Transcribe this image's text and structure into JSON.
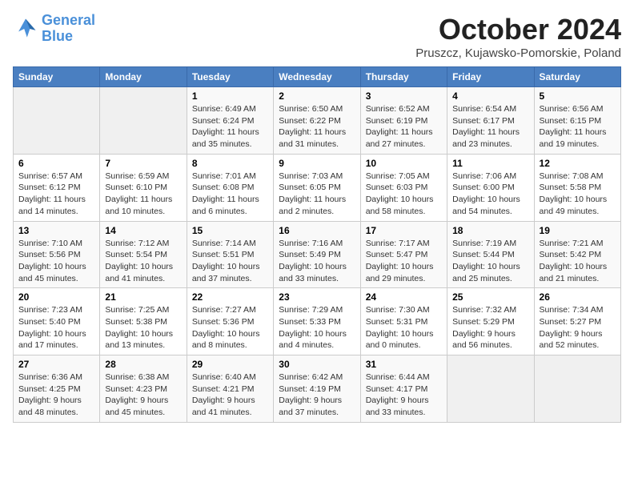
{
  "header": {
    "logo_line1": "General",
    "logo_line2": "Blue",
    "month": "October 2024",
    "location": "Pruszcz, Kujawsko-Pomorskie, Poland"
  },
  "days_of_week": [
    "Sunday",
    "Monday",
    "Tuesday",
    "Wednesday",
    "Thursday",
    "Friday",
    "Saturday"
  ],
  "weeks": [
    [
      {
        "num": "",
        "info": ""
      },
      {
        "num": "",
        "info": ""
      },
      {
        "num": "1",
        "info": "Sunrise: 6:49 AM\nSunset: 6:24 PM\nDaylight: 11 hours and 35 minutes."
      },
      {
        "num": "2",
        "info": "Sunrise: 6:50 AM\nSunset: 6:22 PM\nDaylight: 11 hours and 31 minutes."
      },
      {
        "num": "3",
        "info": "Sunrise: 6:52 AM\nSunset: 6:19 PM\nDaylight: 11 hours and 27 minutes."
      },
      {
        "num": "4",
        "info": "Sunrise: 6:54 AM\nSunset: 6:17 PM\nDaylight: 11 hours and 23 minutes."
      },
      {
        "num": "5",
        "info": "Sunrise: 6:56 AM\nSunset: 6:15 PM\nDaylight: 11 hours and 19 minutes."
      }
    ],
    [
      {
        "num": "6",
        "info": "Sunrise: 6:57 AM\nSunset: 6:12 PM\nDaylight: 11 hours and 14 minutes."
      },
      {
        "num": "7",
        "info": "Sunrise: 6:59 AM\nSunset: 6:10 PM\nDaylight: 11 hours and 10 minutes."
      },
      {
        "num": "8",
        "info": "Sunrise: 7:01 AM\nSunset: 6:08 PM\nDaylight: 11 hours and 6 minutes."
      },
      {
        "num": "9",
        "info": "Sunrise: 7:03 AM\nSunset: 6:05 PM\nDaylight: 11 hours and 2 minutes."
      },
      {
        "num": "10",
        "info": "Sunrise: 7:05 AM\nSunset: 6:03 PM\nDaylight: 10 hours and 58 minutes."
      },
      {
        "num": "11",
        "info": "Sunrise: 7:06 AM\nSunset: 6:00 PM\nDaylight: 10 hours and 54 minutes."
      },
      {
        "num": "12",
        "info": "Sunrise: 7:08 AM\nSunset: 5:58 PM\nDaylight: 10 hours and 49 minutes."
      }
    ],
    [
      {
        "num": "13",
        "info": "Sunrise: 7:10 AM\nSunset: 5:56 PM\nDaylight: 10 hours and 45 minutes."
      },
      {
        "num": "14",
        "info": "Sunrise: 7:12 AM\nSunset: 5:54 PM\nDaylight: 10 hours and 41 minutes."
      },
      {
        "num": "15",
        "info": "Sunrise: 7:14 AM\nSunset: 5:51 PM\nDaylight: 10 hours and 37 minutes."
      },
      {
        "num": "16",
        "info": "Sunrise: 7:16 AM\nSunset: 5:49 PM\nDaylight: 10 hours and 33 minutes."
      },
      {
        "num": "17",
        "info": "Sunrise: 7:17 AM\nSunset: 5:47 PM\nDaylight: 10 hours and 29 minutes."
      },
      {
        "num": "18",
        "info": "Sunrise: 7:19 AM\nSunset: 5:44 PM\nDaylight: 10 hours and 25 minutes."
      },
      {
        "num": "19",
        "info": "Sunrise: 7:21 AM\nSunset: 5:42 PM\nDaylight: 10 hours and 21 minutes."
      }
    ],
    [
      {
        "num": "20",
        "info": "Sunrise: 7:23 AM\nSunset: 5:40 PM\nDaylight: 10 hours and 17 minutes."
      },
      {
        "num": "21",
        "info": "Sunrise: 7:25 AM\nSunset: 5:38 PM\nDaylight: 10 hours and 13 minutes."
      },
      {
        "num": "22",
        "info": "Sunrise: 7:27 AM\nSunset: 5:36 PM\nDaylight: 10 hours and 8 minutes."
      },
      {
        "num": "23",
        "info": "Sunrise: 7:29 AM\nSunset: 5:33 PM\nDaylight: 10 hours and 4 minutes."
      },
      {
        "num": "24",
        "info": "Sunrise: 7:30 AM\nSunset: 5:31 PM\nDaylight: 10 hours and 0 minutes."
      },
      {
        "num": "25",
        "info": "Sunrise: 7:32 AM\nSunset: 5:29 PM\nDaylight: 9 hours and 56 minutes."
      },
      {
        "num": "26",
        "info": "Sunrise: 7:34 AM\nSunset: 5:27 PM\nDaylight: 9 hours and 52 minutes."
      }
    ],
    [
      {
        "num": "27",
        "info": "Sunrise: 6:36 AM\nSunset: 4:25 PM\nDaylight: 9 hours and 48 minutes."
      },
      {
        "num": "28",
        "info": "Sunrise: 6:38 AM\nSunset: 4:23 PM\nDaylight: 9 hours and 45 minutes."
      },
      {
        "num": "29",
        "info": "Sunrise: 6:40 AM\nSunset: 4:21 PM\nDaylight: 9 hours and 41 minutes."
      },
      {
        "num": "30",
        "info": "Sunrise: 6:42 AM\nSunset: 4:19 PM\nDaylight: 9 hours and 37 minutes."
      },
      {
        "num": "31",
        "info": "Sunrise: 6:44 AM\nSunset: 4:17 PM\nDaylight: 9 hours and 33 minutes."
      },
      {
        "num": "",
        "info": ""
      },
      {
        "num": "",
        "info": ""
      }
    ]
  ]
}
